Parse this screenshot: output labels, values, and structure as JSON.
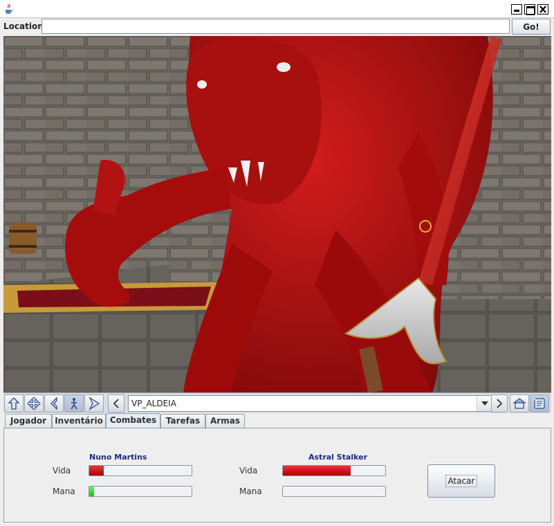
{
  "window": {
    "icon": "java-cup-icon"
  },
  "location": {
    "label": "Location:",
    "value": "",
    "go_label": "Go!"
  },
  "navigation": {
    "buttons": [
      "walk-icon",
      "pan-icon",
      "turn-icon",
      "study-icon",
      "fly-icon"
    ],
    "active_button": "study-icon",
    "prev_label": "‹",
    "viewpoint": "VP_ALDEIA",
    "next_label": "›",
    "home_icon": "home-icon",
    "scroll_icon": "scroll-icon"
  },
  "tabs": [
    {
      "label": "Jogador"
    },
    {
      "label": "Inventário"
    },
    {
      "label": "Combates"
    },
    {
      "label": "Tarefas"
    },
    {
      "label": "Armas"
    }
  ],
  "selected_tab": "Combates",
  "combat": {
    "player": {
      "name": "Nuno Martins",
      "vida_label": "Vida",
      "mana_label": "Mana",
      "vida_fraction": 0.14,
      "mana_fraction": 0.05
    },
    "enemy": {
      "name": "Astral Stalker",
      "vida_label": "Vida",
      "mana_label": "Mana",
      "vida_fraction": 0.66,
      "mana_fraction": 0.0
    },
    "attack_label": "Atacar"
  },
  "colors": {
    "health": "#cc0000",
    "mana": "#22cc22",
    "name_text": "#1a2b8c"
  }
}
